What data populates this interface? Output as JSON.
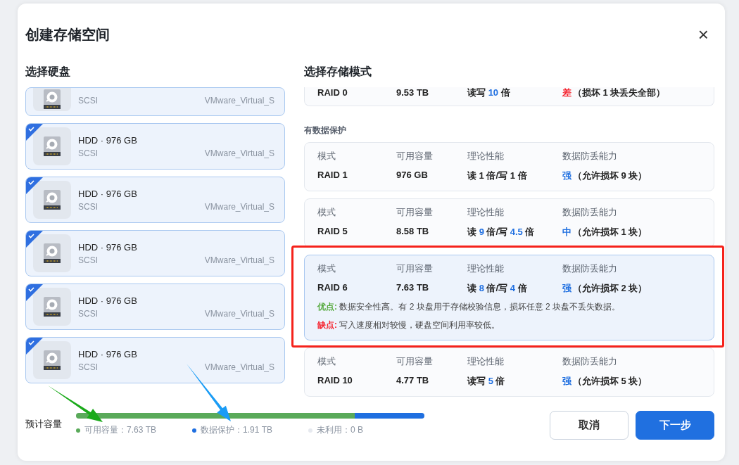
{
  "dialog": {
    "title": "创建存储空间",
    "close": "×"
  },
  "disks": {
    "heading": "选择硬盘",
    "items": [
      {
        "sub": "SCSI",
        "model": "VMware_Virtual_S",
        "cut": true
      },
      {
        "title": "HDD · 976 GB",
        "sub": "SCSI",
        "model": "VMware_Virtual_S",
        "checked": true
      },
      {
        "title": "HDD · 976 GB",
        "sub": "SCSI",
        "model": "VMware_Virtual_S",
        "checked": true
      },
      {
        "title": "HDD · 976 GB",
        "sub": "SCSI",
        "model": "VMware_Virtual_S",
        "checked": true
      },
      {
        "title": "HDD · 976 GB",
        "sub": "SCSI",
        "model": "VMware_Virtual_S",
        "checked": true
      },
      {
        "title": "HDD · 976 GB",
        "sub": "SCSI",
        "model": "VMware_Virtual_S",
        "checked": true
      }
    ]
  },
  "modes": {
    "heading": "选择存储模式",
    "groups": [
      {
        "cards": [
          {
            "cut": true,
            "selected": false,
            "mode": "RAID 0",
            "capacity": "9.53 TB",
            "perf": [
              {
                "text": "读写 "
              },
              {
                "text": "10",
                "hl": true
              },
              {
                "text": " 倍"
              }
            ],
            "level": {
              "text": "差",
              "color": "#f5222d"
            },
            "note": "（损坏 1 块丢失全部）"
          }
        ]
      },
      {
        "label": "有数据保护",
        "cards": [
          {
            "selected": false,
            "headers": [
              "模式",
              "可用容量",
              "理论性能",
              "数据防丢能力"
            ],
            "mode": "RAID 1",
            "capacity": "976 GB",
            "perf": [
              {
                "text": "读 1 倍/写 1 倍"
              }
            ],
            "level": {
              "text": "强",
              "color": "#1f6fe0"
            },
            "note": "（允许损坏 9 块）"
          },
          {
            "selected": false,
            "headers": [
              "模式",
              "可用容量",
              "理论性能",
              "数据防丢能力"
            ],
            "mode": "RAID 5",
            "capacity": "8.58 TB",
            "perf": [
              {
                "text": "读 "
              },
              {
                "text": "9",
                "hl": true
              },
              {
                "text": " 倍/写 "
              },
              {
                "text": "4.5",
                "hl": true
              },
              {
                "text": " 倍"
              }
            ],
            "level": {
              "text": "中",
              "color": "#1f6fe0"
            },
            "note": "（允许损坏 1 块）"
          },
          {
            "selected": true,
            "headers": [
              "模式",
              "可用容量",
              "理论性能",
              "数据防丢能力"
            ],
            "mode": "RAID 6",
            "capacity": "7.63 TB",
            "perf": [
              {
                "text": "读 "
              },
              {
                "text": "8",
                "hl": true
              },
              {
                "text": " 倍/写 "
              },
              {
                "text": "4",
                "hl": true
              },
              {
                "text": " 倍"
              }
            ],
            "level": {
              "text": "强",
              "color": "#1f6fe0"
            },
            "note": "（允许损坏 2 块）",
            "details": [
              {
                "label": "优点:",
                "color": "#52a839",
                "text": "数据安全性高。有 2 块盘用于存储校验信息，损坏任意 2 块盘不丢失数据。"
              },
              {
                "label": "缺点:",
                "color": "#f5222d",
                "text": "写入速度相对较慢，硬盘空间利用率较低。"
              }
            ]
          },
          {
            "selected": false,
            "headers": [
              "模式",
              "可用容量",
              "理论性能",
              "数据防丢能力"
            ],
            "mode": "RAID 10",
            "capacity": "4.77 TB",
            "perf": [
              {
                "text": "读写 "
              },
              {
                "text": "5",
                "hl": true
              },
              {
                "text": " 倍"
              }
            ],
            "level": {
              "text": "强",
              "color": "#1f6fe0"
            },
            "note": "（允许损坏 5 块）"
          }
        ]
      }
    ]
  },
  "capacity": {
    "label": "预计容量",
    "segments": [
      {
        "name": "可用容量：7.63 TB",
        "color": "#5aaa5a",
        "level": 0.8
      },
      {
        "name": "数据保护：1.91 TB",
        "color": "#1f6fe0",
        "level": 0.2
      },
      {
        "name": "未利用：0 B",
        "color": "#e6e9ef"
      }
    ]
  },
  "buttons": [
    {
      "label": "取消",
      "kind": "secondary"
    },
    {
      "label": "下一步",
      "kind": "primary"
    }
  ],
  "annotations": [
    {
      "kind": "box",
      "color": "#f5221b"
    },
    {
      "kind": "arrow",
      "color": "#1aaa1a"
    },
    {
      "kind": "arrow",
      "color": "#1a9cf5"
    }
  ]
}
